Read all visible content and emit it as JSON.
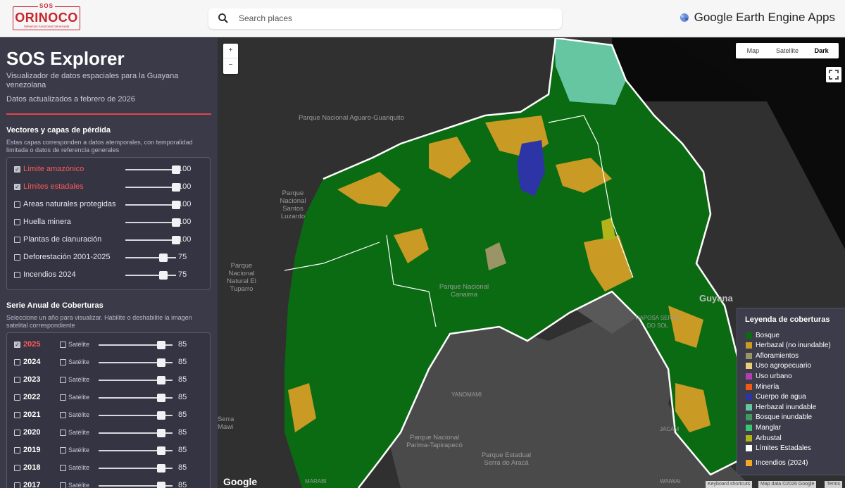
{
  "header": {
    "logo_top": "SOS",
    "logo_main": "ORINOCO",
    "logo_sub": "Salvemos Amazonas Venezuela",
    "search_placeholder": "Search places",
    "brand": "Google Earth Engine Apps"
  },
  "sidebar": {
    "title": "SOS Explorer",
    "subtitle": "Visualizador de datos espaciales para la Guayana venezolana",
    "updated": "Datos actualizados a febrero de 2026",
    "vectors": {
      "title": "Vectores y capas de pérdida",
      "description": "Estas capas corresponden a datos atemporales, con temporalidad limitada o datos de referencia generales",
      "layers": [
        {
          "label": "Límite amazónico",
          "checked": true,
          "value": "100",
          "level": 1.0
        },
        {
          "label": "Límites estadales",
          "checked": true,
          "value": "100",
          "level": 1.0
        },
        {
          "label": "Areas naturales protegidas",
          "checked": false,
          "value": "100",
          "level": 1.0
        },
        {
          "label": "Huella minera",
          "checked": false,
          "value": "100",
          "level": 1.0
        },
        {
          "label": "Plantas de cianuración",
          "checked": false,
          "value": "100",
          "level": 1.0
        },
        {
          "label": "Deforestación 2001-2025",
          "checked": false,
          "value": "75",
          "level": 0.75
        },
        {
          "label": "Incendios 2024",
          "checked": false,
          "value": "75",
          "level": 0.75
        }
      ]
    },
    "annual": {
      "title": "Serie Anual de Coberturas",
      "description": "Seleccione un año para visualizar. Habilite o deshabilite la imagen satelital correspondiente",
      "satellite_label": "Satélite",
      "years": [
        {
          "year": "2025",
          "checked": true,
          "value": "85",
          "level": 0.85
        },
        {
          "year": "2024",
          "checked": false,
          "value": "85",
          "level": 0.85
        },
        {
          "year": "2023",
          "checked": false,
          "value": "85",
          "level": 0.85
        },
        {
          "year": "2022",
          "checked": false,
          "value": "85",
          "level": 0.85
        },
        {
          "year": "2021",
          "checked": false,
          "value": "85",
          "level": 0.85
        },
        {
          "year": "2020",
          "checked": false,
          "value": "85",
          "level": 0.85
        },
        {
          "year": "2019",
          "checked": false,
          "value": "85",
          "level": 0.85
        },
        {
          "year": "2018",
          "checked": false,
          "value": "85",
          "level": 0.85
        },
        {
          "year": "2017",
          "checked": false,
          "value": "85",
          "level": 0.85
        }
      ]
    }
  },
  "map": {
    "zoom_in": "+",
    "zoom_out": "−",
    "types": [
      "Map",
      "Satellite",
      "Dark"
    ],
    "active_type": "Dark",
    "labels": {
      "aguaro": "Parque Nacional Aguaro-Guariquito",
      "santos": "Parque Nacional Santos Luzardo",
      "tuparro": "Parque Nacional Natural El Tuparro",
      "canaima": "Parque Nacional Canaima",
      "raposa": "RAPOSA SERRA DO SOL",
      "guyana": "Guyana",
      "yanomami": "YANOMAMI",
      "parima": "Parque Nacional Parima-Tapirapecó",
      "araca": "Parque Estadual Serra do Aracá",
      "serra": "Serra Mawi",
      "jacam": "JACAM",
      "waiwai": "WAIWAI",
      "marabi": "MARABI"
    },
    "google": "Google",
    "attribution": [
      "Keyboard shortcuts",
      "Map data ©2026 Google",
      "Terms"
    ]
  },
  "legend": {
    "title": "Leyenda de coberturas",
    "items": [
      {
        "label": "Bosque",
        "color": "#0b6b12"
      },
      {
        "label": "Herbazal (no inundable)",
        "color": "#c99a24"
      },
      {
        "label": "Afloramientos",
        "color": "#9a9467"
      },
      {
        "label": "Uso agropecuario",
        "color": "#e8cf79"
      },
      {
        "label": "Uso urbano",
        "color": "#b43fb1"
      },
      {
        "label": "Minería",
        "color": "#f05a12"
      },
      {
        "label": "Cuerpo de agua",
        "color": "#2d35a6"
      },
      {
        "label": "Herbazal inundable",
        "color": "#66c6a2"
      },
      {
        "label": "Bosque inundable",
        "color": "#3e9b5c"
      },
      {
        "label": "Manglar",
        "color": "#39c76f"
      },
      {
        "label": "Arbustal",
        "color": "#b3b41a"
      },
      {
        "label": "Límites Estadales",
        "color": "#ffffff"
      },
      {
        "label": "Incendios (2024)",
        "color": "#f5a623"
      }
    ]
  }
}
